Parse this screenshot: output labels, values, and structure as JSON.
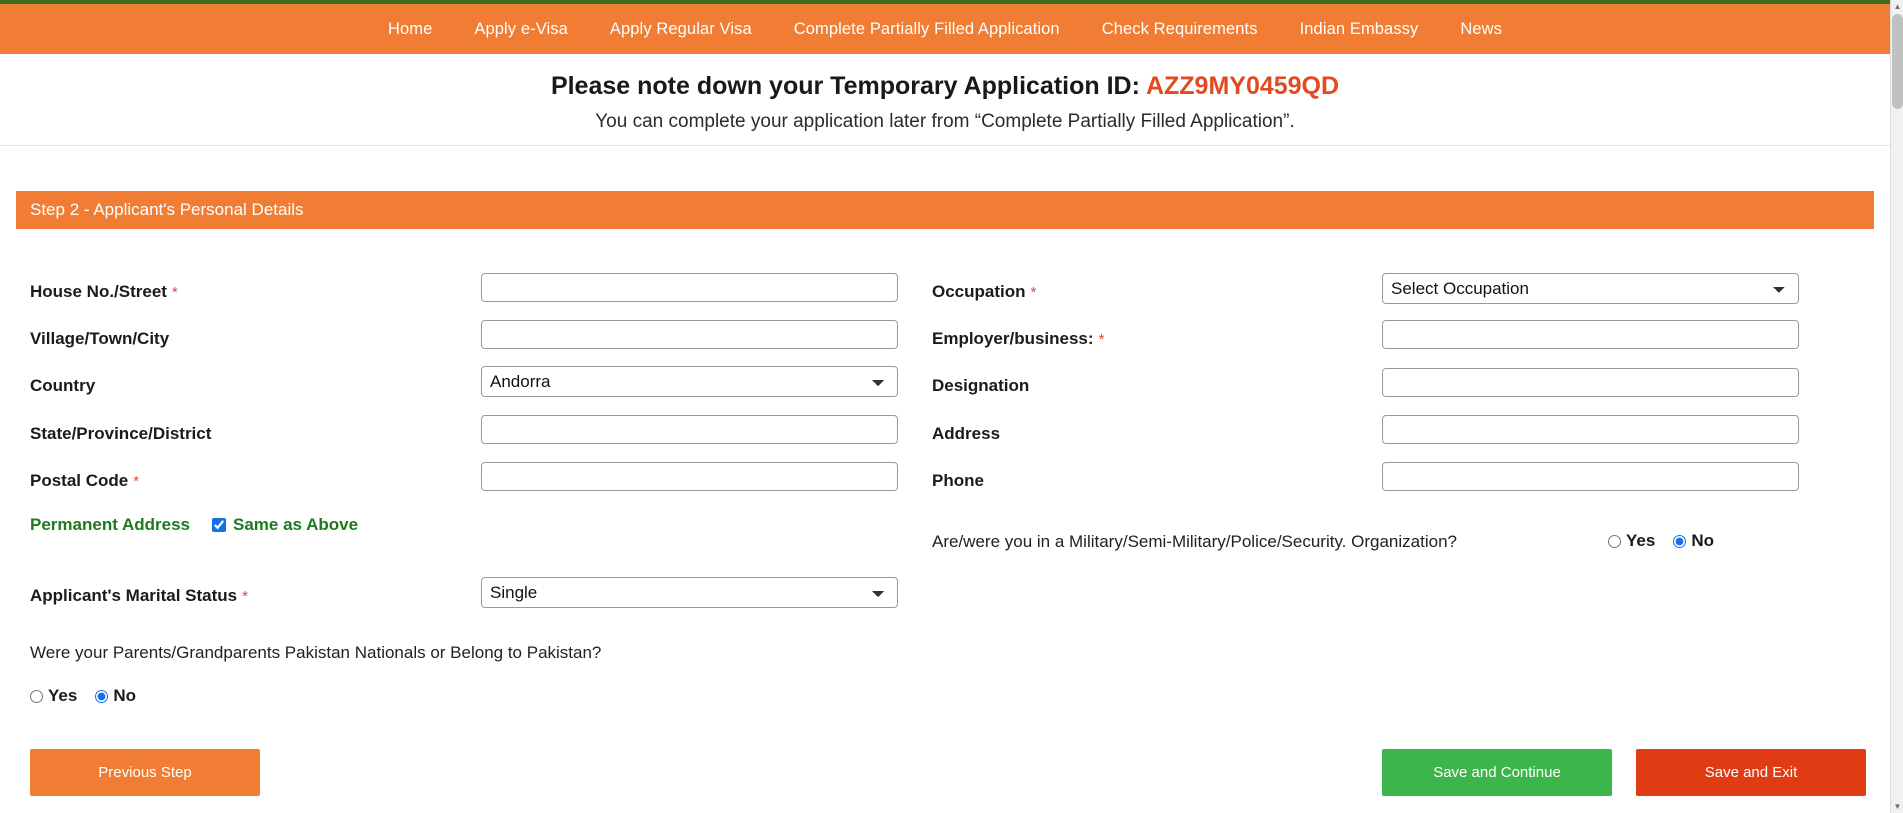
{
  "theme": {
    "nav_bg": "#f07d33",
    "accent_orange": "#f07d33",
    "id_red": "#e24a20",
    "green": "#1d7a1d",
    "button_green": "#3cb54a",
    "button_red": "#e03c14",
    "required_red": "#e8443a",
    "top_rule_green": "#3a6b1f"
  },
  "nav": {
    "items": [
      {
        "label": "Home",
        "name": "nav-home"
      },
      {
        "label": "Apply e-Visa",
        "name": "nav-apply-evisa"
      },
      {
        "label": "Apply Regular Visa",
        "name": "nav-apply-regular-visa"
      },
      {
        "label": "Complete Partially Filled Application",
        "name": "nav-complete-partially-filled-application"
      },
      {
        "label": "Check Requirements",
        "name": "nav-check-requirements"
      },
      {
        "label": "Indian Embassy",
        "name": "nav-indian-embassy"
      },
      {
        "label": "News",
        "name": "nav-news"
      }
    ]
  },
  "notice": {
    "title_prefix": "Please note down your Temporary Application ID: ",
    "application_id": "AZZ9MY0459QD",
    "subtitle": "You can complete your application later from “Complete Partially Filled Application”."
  },
  "step": {
    "header": "Step 2 - Applicant's Personal Details"
  },
  "form": {
    "left": {
      "house_street": {
        "label": "House No./Street",
        "required": true,
        "value": "",
        "placeholder": ""
      },
      "village_town_city": {
        "label": "Village/Town/City",
        "required": false,
        "value": "",
        "placeholder": ""
      },
      "country": {
        "label": "Country",
        "required": false,
        "value": "Andorra",
        "options": [
          "Andorra"
        ]
      },
      "state_province_district": {
        "label": "State/Province/District",
        "required": false,
        "value": "",
        "placeholder": ""
      },
      "postal_code": {
        "label": "Postal Code",
        "required": true,
        "value": "",
        "placeholder": ""
      },
      "permanent_address": {
        "label": "Permanent Address",
        "same_as_above_label": "Same as Above",
        "checked": true
      },
      "marital_status": {
        "label": "Applicant's Marital Status",
        "required": true,
        "value": "Single",
        "options": [
          "Single"
        ]
      },
      "pakistan_question": {
        "text": "Were your Parents/Grandparents Pakistan Nationals or Belong to Pakistan?",
        "yes_label": "Yes",
        "no_label": "No",
        "selected": "No"
      }
    },
    "right": {
      "occupation": {
        "label": "Occupation",
        "required": true,
        "value": "Select Occupation",
        "options": [
          "Select Occupation"
        ]
      },
      "employer_business": {
        "label": "Employer/business:",
        "required": true,
        "value": "",
        "placeholder": ""
      },
      "designation": {
        "label": "Designation",
        "required": false,
        "value": "",
        "placeholder": ""
      },
      "address": {
        "label": "Address",
        "required": false,
        "value": "",
        "placeholder": ""
      },
      "phone": {
        "label": "Phone",
        "required": false,
        "value": "",
        "placeholder": ""
      },
      "military_question": {
        "text": "Are/were you in a Military/Semi-Military/Police/Security. Organization?",
        "yes_label": "Yes",
        "no_label": "No",
        "selected": "No"
      }
    }
  },
  "buttons": {
    "previous": "Previous Step",
    "save_continue": "Save and Continue",
    "save_exit": "Save and Exit"
  },
  "icons": {
    "scroll_up": "▲",
    "scroll_down": "▼",
    "required_mark": "*"
  }
}
